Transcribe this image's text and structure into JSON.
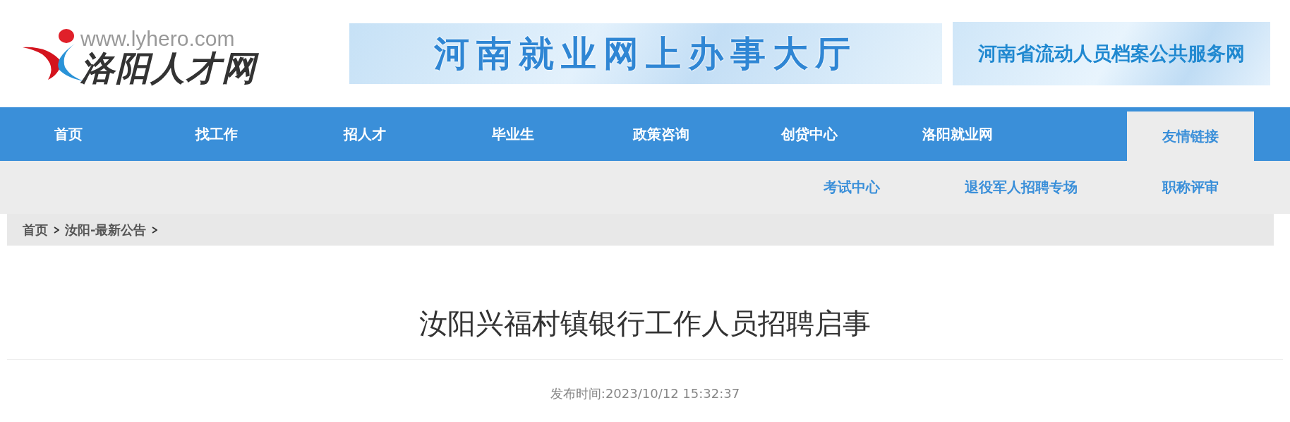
{
  "logo": {
    "url": "www.lyhero.com",
    "name": "洛阳人才网"
  },
  "banners": [
    "河南就业网上办事大厅",
    "河南省流动人员档案公共服务网"
  ],
  "nav": [
    {
      "label": "首页",
      "selected": false
    },
    {
      "label": "找工作",
      "selected": false
    },
    {
      "label": "招人才",
      "selected": false
    },
    {
      "label": "毕业生",
      "selected": false
    },
    {
      "label": "政策咨询",
      "selected": false
    },
    {
      "label": "创贷中心",
      "selected": false
    },
    {
      "label": "洛阳就业网",
      "selected": false
    },
    {
      "label": "友情链接",
      "selected": true
    }
  ],
  "subnav": [
    "考试中心",
    "退役军人招聘专场",
    "职称评审"
  ],
  "breadcrumb": [
    "首页",
    "汝阳-最新公告"
  ],
  "article": {
    "title": "汝阳兴福村镇银行工作人员招聘启事",
    "date": "发布时间:2023/10/12 15:32:37"
  }
}
